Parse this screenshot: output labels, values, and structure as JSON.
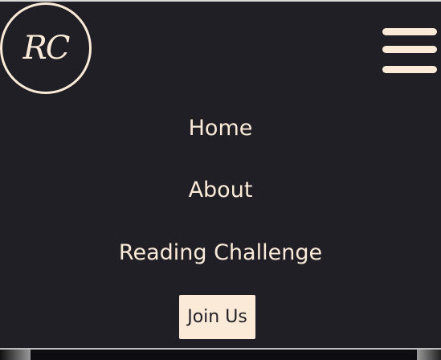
{
  "header": {
    "logo_text": "RC",
    "menu_icon": "hamburger-menu-icon"
  },
  "nav": {
    "items": [
      {
        "label": "Home"
      },
      {
        "label": "About"
      },
      {
        "label": "Reading Challenge"
      }
    ],
    "cta_label": "Join Us"
  },
  "colors": {
    "background": "#211f26",
    "accent": "#fbead8"
  }
}
